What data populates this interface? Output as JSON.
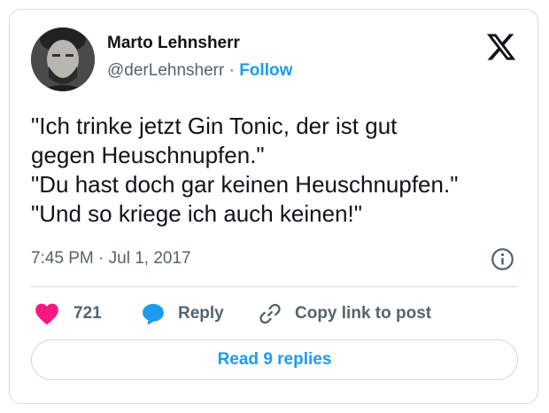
{
  "author": {
    "display_name": "Marto Lehnsherr",
    "handle": "@derLehnsherr",
    "separator": " · ",
    "follow_label": "Follow"
  },
  "tweet": {
    "lines": [
      "\"Ich trinke jetzt Gin Tonic, der ist gut",
      "gegen Heuschnupfen.\"",
      "\"Du hast doch gar keinen Heuschnupfen.\"",
      "\"Und so kriege ich auch keinen!\""
    ],
    "timestamp": "7:45 PM · Jul 1, 2017"
  },
  "actions": {
    "like_count": "721",
    "reply_label": "Reply",
    "copy_label": "Copy link to post"
  },
  "read_replies_label": "Read 9 replies",
  "icons": {
    "brand": "x-logo-icon",
    "info": "info-icon",
    "like": "heart-icon",
    "reply": "speech-bubble-icon",
    "copy": "link-icon"
  },
  "colors": {
    "accent": "#1d9bf0",
    "like": "#f91880",
    "text": "#0f1419",
    "secondary": "#536471",
    "border": "#cfd9de"
  }
}
